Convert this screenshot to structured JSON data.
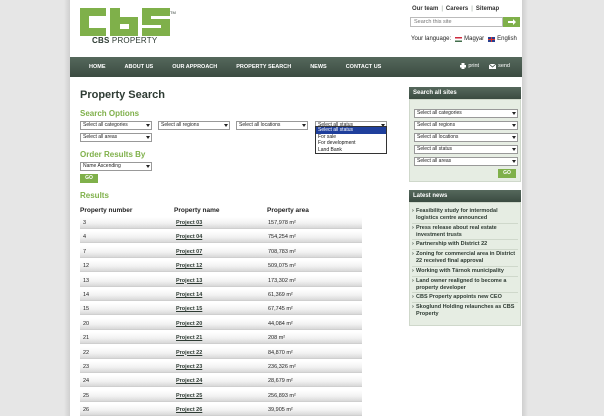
{
  "header": {
    "logo_alt": "cbs",
    "logo_brand": "CBS",
    "logo_tail": " PROPERTY",
    "top_links": [
      "Our team",
      "Careers",
      "Sitemap"
    ],
    "search_placeholder": "Search this site",
    "language_label": "Your language:",
    "languages": [
      "Magyar",
      "English"
    ]
  },
  "nav": {
    "items": [
      "HOME",
      "ABOUT US",
      "OUR APPROACH",
      "PROPERTY SEARCH",
      "NEWS",
      "CONTACT US"
    ],
    "print": "print",
    "send": "send"
  },
  "main": {
    "title": "Property Search",
    "search_options": "Search Options",
    "filters": [
      "Select all categories",
      "Select all regions",
      "Select all locations",
      "Select all status",
      "Select all areas"
    ],
    "status_options": [
      "Select all status",
      "For sale",
      "For development",
      "Land Bank"
    ],
    "order_title": "Order Results By",
    "order_value": "Name Ascending",
    "go": "GO",
    "results_title": "Results",
    "columns": [
      "Property number",
      "Property name",
      "Property area"
    ],
    "rows": [
      [
        "3",
        "Project 03",
        "157,978 m²"
      ],
      [
        "4",
        "Project 04",
        "754,254 m²"
      ],
      [
        "7",
        "Project 07",
        "708,783 m²"
      ],
      [
        "12",
        "Project 12",
        "509,075 m²"
      ],
      [
        "13",
        "Project 13",
        "173,302 m²"
      ],
      [
        "14",
        "Project 14",
        "61,369 m²"
      ],
      [
        "15",
        "Project 15",
        "67,745 m²"
      ],
      [
        "20",
        "Project 20",
        "44,084 m²"
      ],
      [
        "21",
        "Project 21",
        "208 m²"
      ],
      [
        "22",
        "Project 22",
        "84,870 m²"
      ],
      [
        "23",
        "Project 23",
        "236,326 m²"
      ],
      [
        "24",
        "Project 24",
        "28,679 m²"
      ],
      [
        "25",
        "Project 25",
        "256,893 m²"
      ],
      [
        "26",
        "Project 26",
        "39,905 m²"
      ]
    ]
  },
  "sidebar": {
    "search_title": "Search all sites",
    "filters": [
      "Select all categories",
      "Select all regions",
      "Select all locations",
      "Select all status",
      "Select all areas"
    ],
    "go": "GO",
    "news_title": "Latest news",
    "news": [
      "Feasibility study for intermodal logistics centre announced",
      "Press release about real estate investment trusts",
      "Partnership with District 22",
      "Zoning for commercial area in District 22 received final approval",
      "Working with Tárnok municipality",
      "Land owner realigned to become a property developer",
      "CBS Property appoints new CEO",
      "Skoglund Holding relaunches as CBS Property"
    ]
  },
  "colors": {
    "accent": "#7fb04a",
    "dark": "#3b4b41",
    "background": "#e6e6e6"
  }
}
